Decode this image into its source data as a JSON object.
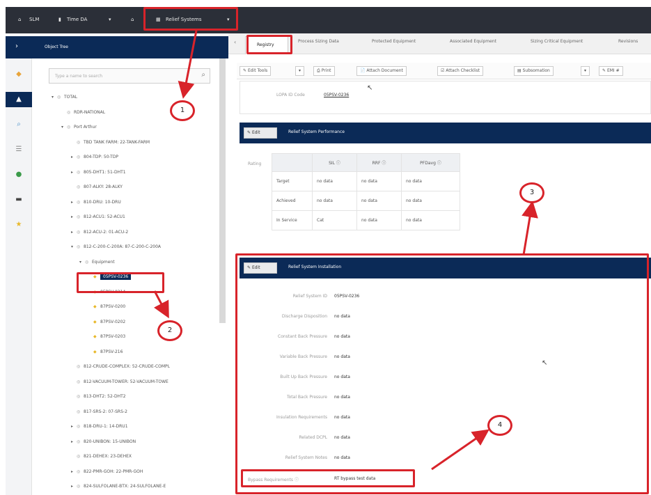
{
  "topbar": {
    "app_label": "SLM",
    "project_label": "Time DA",
    "menu_label": "Relief Systems"
  },
  "left_panel": {
    "title": "Object Tree",
    "search_placeholder": "Type a name to search",
    "rail_icons": [
      "cube-icon",
      "tree-icon",
      "search-icon",
      "hierarchy-icon",
      "globe-icon",
      "minus-icon",
      "star-icon"
    ],
    "tree": [
      {
        "label": "TOTAL",
        "toggle": "▾"
      },
      {
        "label": "RDR-NATIONAL",
        "toggle": ""
      },
      {
        "label": "Port Arthur",
        "toggle": "▾"
      },
      {
        "label": "TBD TANK FARM: 22-TANK-FARM",
        "toggle": ""
      },
      {
        "label": "804-TDP: 50-TDP",
        "toggle": "▸"
      },
      {
        "label": "805-DHT1: 51-DHT1",
        "toggle": "▸"
      },
      {
        "label": "807-ALKY: 28-ALKY",
        "toggle": ""
      },
      {
        "label": "810-DRU: 10-DRU",
        "toggle": "▸"
      },
      {
        "label": "812-ACU1: 52-ACU1",
        "toggle": "▸"
      },
      {
        "label": "812-ACU-2: 01-ACU-2",
        "toggle": "▸"
      },
      {
        "label": "812-C-200-C-200A: 87-C-200-C-200A",
        "toggle": "▾"
      },
      {
        "label": "Equipment",
        "toggle": "▾"
      },
      {
        "label": "05PSV-0236",
        "toggle": ""
      },
      {
        "label": "05PSV-0214",
        "toggle": ""
      },
      {
        "label": "87PSV-0200",
        "toggle": ""
      },
      {
        "label": "87PSV-0202",
        "toggle": ""
      },
      {
        "label": "87PSV-0203",
        "toggle": ""
      },
      {
        "label": "87PSV-216",
        "toggle": ""
      },
      {
        "label": "812-CRUDE-COMPLEX: 52-CRUDE-COMPL",
        "toggle": ""
      },
      {
        "label": "812-VACUUM-TOWER: 52-VACUUM-TOWE",
        "toggle": ""
      },
      {
        "label": "813-DHT2: 52-DHT2",
        "toggle": ""
      },
      {
        "label": "817-SRS-2: 07-SRS-2",
        "toggle": ""
      },
      {
        "label": "818-DRU-1: 14-DRU1",
        "toggle": "▸"
      },
      {
        "label": "820-UNIBON: 15-UNIBON",
        "toggle": "▸"
      },
      {
        "label": "821-DEHEX: 23-DEHEX",
        "toggle": ""
      },
      {
        "label": "822-PMR-GOH: 22-PMR-GOH",
        "toggle": "▸"
      },
      {
        "label": "824-SULFOLANE-BTX: 24-SULFOLANE-E",
        "toggle": "▸"
      }
    ]
  },
  "tabs": [
    "Registry",
    "Process Sizing Data",
    "Protected Equipment",
    "Associated Equipment",
    "Sizing Critical Equipment",
    "Revisions"
  ],
  "toolbar": [
    "Edit Tools",
    "Print",
    "Attach Document",
    "Attach Checklist",
    "Subsomation",
    "EMI #"
  ],
  "top_field": {
    "label": "LOPA ID Code",
    "value": "05PSV-0236"
  },
  "performance": {
    "edit_label": "Edit",
    "title": "Relief System Performance",
    "rating_label": "Rating",
    "columns": [
      "SIL",
      "RRF",
      "PFDavg"
    ],
    "rows": [
      {
        "label": "Target",
        "values": [
          "no data",
          "no data",
          "no data"
        ]
      },
      {
        "label": "Achieved",
        "values": [
          "no data",
          "no data",
          "no data"
        ]
      },
      {
        "label": "In Service",
        "values": [
          "Cat",
          "no data",
          "no data"
        ]
      }
    ]
  },
  "installation": {
    "edit_label": "Edit",
    "title": "Relief System Installation",
    "fields": [
      {
        "label": "Relief System ID",
        "value": "05PSV-0236"
      },
      {
        "label": "Discharge Disposition",
        "value": "no data"
      },
      {
        "label": "Constant Back Pressure",
        "value": "no data"
      },
      {
        "label": "Variable Back Pressure",
        "value": "no data"
      },
      {
        "label": "Built Up Back Pressure",
        "value": "no data"
      },
      {
        "label": "Total Back Pressure",
        "value": "no data"
      },
      {
        "label": "Insulation Requirements",
        "value": "no data"
      },
      {
        "label": "Related DCPL",
        "value": "no data"
      },
      {
        "label": "Relief System Notes",
        "value": "no data"
      }
    ],
    "bypass": {
      "label": "Bypass Requirements",
      "value": "RT bypass test data"
    }
  },
  "callouts": [
    "1",
    "2",
    "3",
    "4"
  ],
  "colors": {
    "navy": "#0b2a57",
    "red": "#d8232a",
    "topbar": "#2b2f38"
  }
}
